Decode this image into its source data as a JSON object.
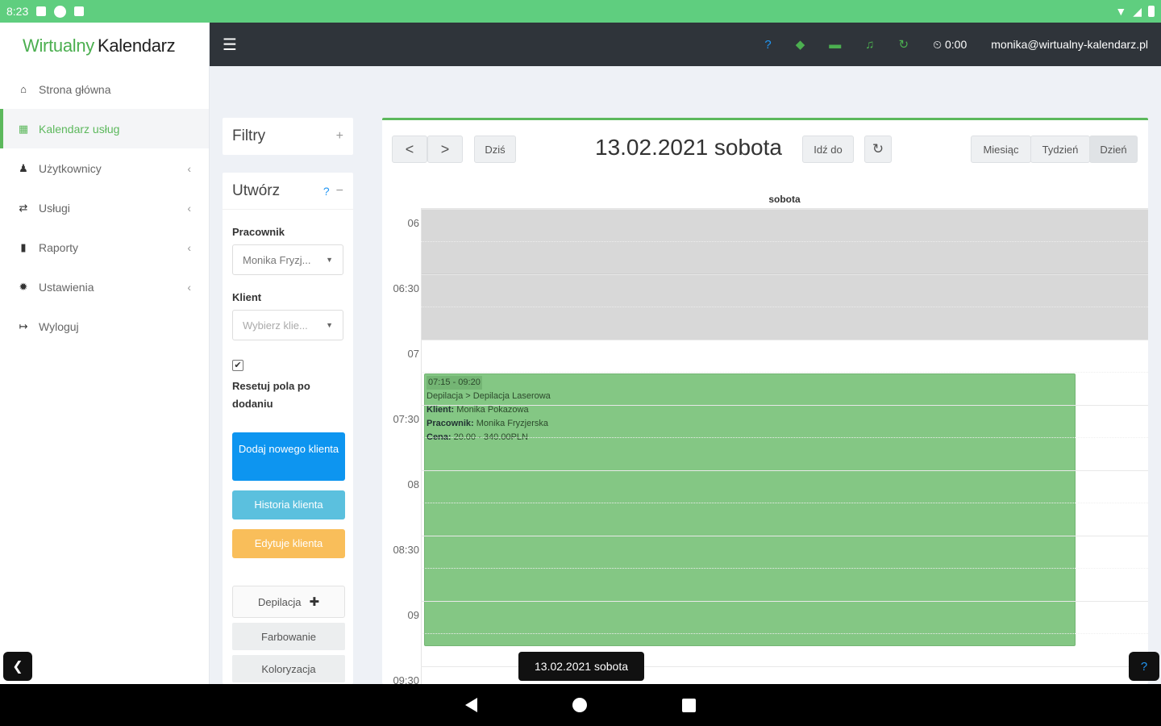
{
  "status_bar": {
    "time": "8:23"
  },
  "app": {
    "logo_part1": "Wirtualny",
    "logo_part2": "Kalendarz"
  },
  "sidebar": {
    "items": [
      {
        "label": "Strona główna",
        "icon": "home-icon",
        "glyph": "⌂",
        "active": false,
        "has_chevron": false
      },
      {
        "label": "Kalendarz usług",
        "icon": "calendar-icon",
        "glyph": "▦",
        "active": true,
        "has_chevron": false
      },
      {
        "label": "Użytkownicy",
        "icon": "user-icon",
        "glyph": "♟",
        "active": false,
        "has_chevron": true
      },
      {
        "label": "Usługi",
        "icon": "exchange-icon",
        "glyph": "⇄",
        "active": false,
        "has_chevron": true
      },
      {
        "label": "Raporty",
        "icon": "bar-chart-icon",
        "glyph": "▮",
        "active": false,
        "has_chevron": true
      },
      {
        "label": "Ustawienia",
        "icon": "gear-icon",
        "glyph": "✹",
        "active": false,
        "has_chevron": true
      },
      {
        "label": "Wyloguj",
        "icon": "sign-out-icon",
        "glyph": "↦",
        "active": false,
        "has_chevron": false
      }
    ],
    "chevron": "‹"
  },
  "topbar": {
    "timer": "0:00",
    "email": "monika@wirtualny-kalendarz.pl"
  },
  "filters": {
    "title": "Filtry",
    "toggle": "+"
  },
  "create": {
    "title": "Utwórz",
    "toggle": "−",
    "employee_label": "Pracownik",
    "employee_value": "Monika Fryzj...",
    "client_label": "Klient",
    "client_placeholder": "Wybierz klie...",
    "reset_checked": true,
    "reset_label": "Resetuj pola po dodaniu",
    "btn_add_client": "Dodaj nowego klienta",
    "btn_history": "Historia klienta",
    "btn_edit": "Edytuje klienta",
    "services": [
      {
        "label": "Depilacja",
        "expandable": true
      },
      {
        "label": "Farbowanie",
        "expandable": false
      },
      {
        "label": "Koloryzacja",
        "expandable": false
      }
    ]
  },
  "calendar": {
    "prev": "<",
    "next": ">",
    "today": "Dziś",
    "title": "13.02.2021 sobota",
    "goto": "Idź do",
    "refresh": "↻",
    "views": [
      "Miesiąc",
      "Tydzień",
      "Dzień"
    ],
    "active_view": "Dzień",
    "day_header": "sobota",
    "time_labels": [
      "06",
      "06:30",
      "07",
      "07:30",
      "08",
      "08:30",
      "09",
      "09:30"
    ],
    "closed_until": "07",
    "event": {
      "time": "07:15 - 09:20",
      "service": "Depilacja > Depilacja Laserowa",
      "client_label": "Klient:",
      "client": "Monika Pokazowa",
      "employee_label": "Pracownik:",
      "employee": "Monika Fryzjerska",
      "price_label": "Cena:",
      "price": "20.00 - 340.00PLN",
      "color": "#84c784"
    },
    "tooltip": "13.02.2021 sobota"
  },
  "colors": {
    "status_bar": "#5fce7f",
    "topbar": "#2f343a",
    "accent": "#5cb85c",
    "primary": "#0d95f0",
    "info": "#5bc0de",
    "warning": "#f9be5a"
  }
}
